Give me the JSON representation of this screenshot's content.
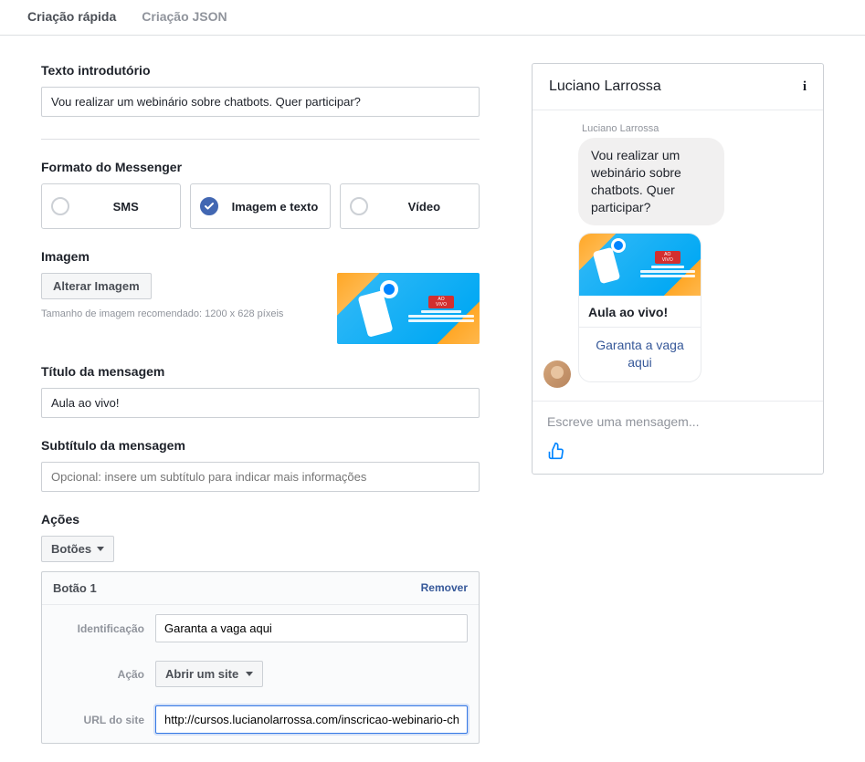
{
  "tabs": {
    "quick": "Criação rápida",
    "json": "Criação JSON"
  },
  "intro": {
    "label": "Texto introdutório",
    "value": "Vou realizar um webinário sobre chatbots. Quer participar?"
  },
  "format": {
    "label": "Formato do Messenger",
    "options": [
      "SMS",
      "Imagem e texto",
      "Vídeo"
    ],
    "selected_index": 1
  },
  "image": {
    "label": "Imagem",
    "change_button": "Alterar Imagem",
    "hint": "Tamanho de imagem recomendado: 1200 x 628 píxeis"
  },
  "title": {
    "label": "Título da mensagem",
    "value": "Aula ao vivo!"
  },
  "subtitle": {
    "label": "Subtítulo da mensagem",
    "placeholder": "Opcional: insere um subtítulo para indicar mais informações"
  },
  "actions": {
    "label": "Ações",
    "dropdown": "Botões"
  },
  "button1": {
    "header": "Botão 1",
    "remove": "Remover",
    "id_label": "Identificação",
    "id_value": "Garanta a vaga aqui",
    "action_label": "Ação",
    "action_value": "Abrir um site",
    "url_label": "URL do site",
    "url_value": "http://cursos.lucianolarrossa.com/inscricao-webinario-chatbots-para-negocios/"
  },
  "preview": {
    "title": "Luciano Larrossa",
    "sender": "Luciano Larrossa",
    "bubble": "Vou realizar um webinário sobre chatbots. Quer participar?",
    "card_title": "Aula ao vivo!",
    "card_action": "Garanta a vaga aqui",
    "composer_placeholder": "Escreve uma mensagem..."
  }
}
